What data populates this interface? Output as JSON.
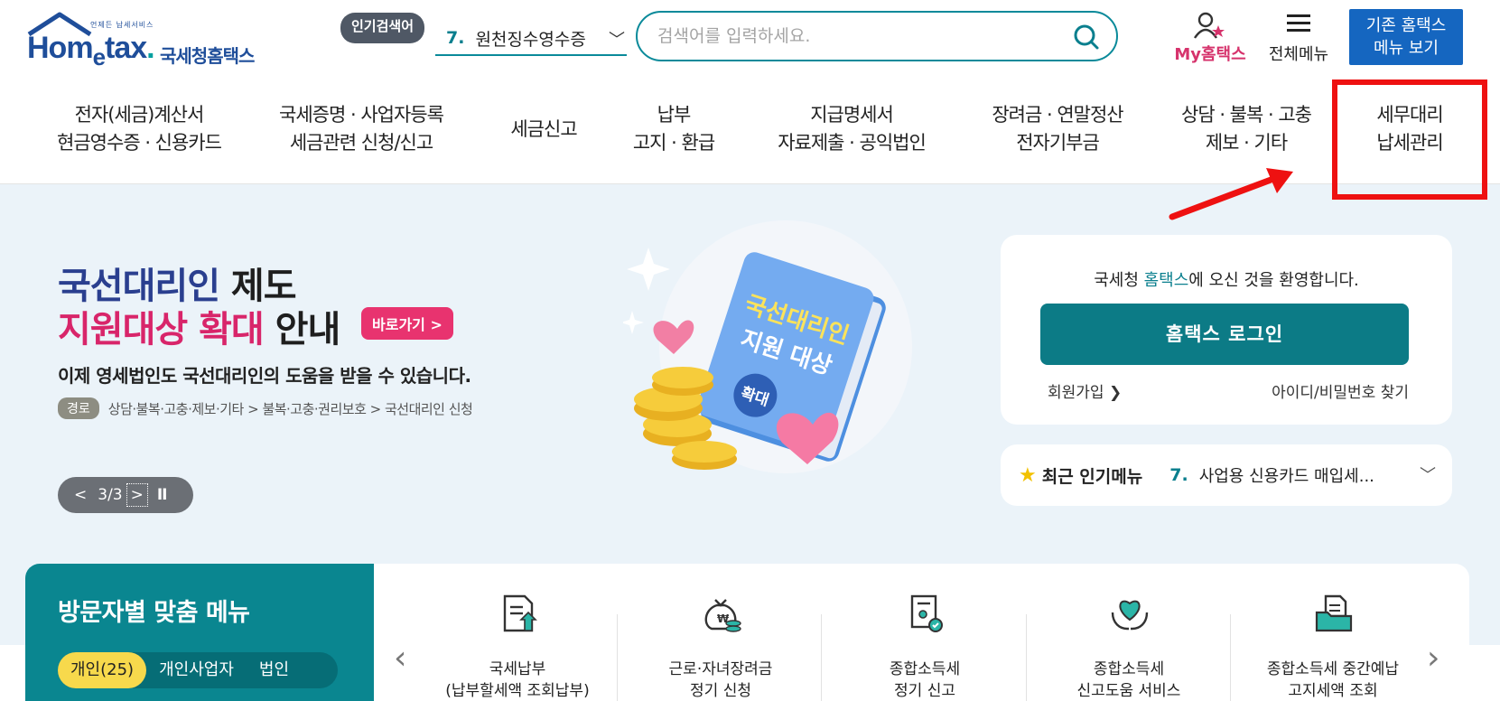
{
  "header": {
    "logo_tagline": "언제든 납세서비스",
    "logo_brand_pre": "Hom",
    "logo_brand_e": "e",
    "logo_brand_post": "tax",
    "logo_brand_dot": ".",
    "logo_kr": "국세청홈택스",
    "popular_badge": "인기검색어",
    "popular_num": "7.",
    "popular_text": "원천징수영수증",
    "search_placeholder": "검색어를 입력하세요.",
    "my_label": "My홈택스",
    "all_menu_label": "전체메뉴",
    "old_menu_line1": "기존 홈택스",
    "old_menu_line2": "메뉴 보기"
  },
  "nav": {
    "items": [
      {
        "l1": "전자(세금)계산서",
        "l2": "현금영수증 · 신용카드"
      },
      {
        "l1": "국세증명 · 사업자등록",
        "l2": "세금관련 신청/신고"
      },
      {
        "l1": "세금신고",
        "l2": ""
      },
      {
        "l1": "납부",
        "l2": "고지 · 환급"
      },
      {
        "l1": "지급명세서",
        "l2": "자료제출 · 공익법인"
      },
      {
        "l1": "장려금 · 연말정산",
        "l2": "전자기부금"
      },
      {
        "l1": "상담 · 불복 · 고충",
        "l2": "제보 · 기타"
      },
      {
        "l1": "세무대리",
        "l2": "납세관리"
      }
    ],
    "annotation_color": "#ee1111"
  },
  "hero": {
    "title1_a": "국선대리인",
    "title1_b": " 제도",
    "title2_a": "지원대상 확대",
    "title2_b": " 안내",
    "go_button": "바로가기 >",
    "subtitle": "이제 영세법인도 국선대리인의 도움을 받을 수 있습니다.",
    "route_tag": "경로",
    "route_path": "상담·불복·고충·제보·기타 > 불복·고충·권리보호 > 국선대리인 신청",
    "pager_prev": "<",
    "pager_count": "3/3",
    "pager_next": ">",
    "pager_pause": "II",
    "book_line1": "국선대리인",
    "book_line2": "지원 대상",
    "book_badge": "확대"
  },
  "login": {
    "welcome_a": "국세청 ",
    "welcome_hl": "홈택스",
    "welcome_b": "에 오신 것을 환영합니다.",
    "login_button": "홈택스 로그인",
    "join": "회원가입 ❯",
    "find": "아이디/비밀번호 찾기"
  },
  "popular_menu": {
    "title": "최근 인기메뉴",
    "num": "7.",
    "text": "사업용 신용카드 매입세..."
  },
  "visitor": {
    "title": "방문자별 맞춤 메뉴",
    "tabs": [
      "개인(25)",
      "개인사업자",
      "법인"
    ]
  },
  "services": [
    {
      "l1": "국세납부",
      "l2": "(납부할세액 조회납부)",
      "icon": "document-upload-icon"
    },
    {
      "l1": "근로·자녀장려금",
      "l2": "정기 신청",
      "icon": "money-bag-icon"
    },
    {
      "l1": "종합소득세",
      "l2": "정기 신고",
      "icon": "certificate-icon"
    },
    {
      "l1": "종합소득세",
      "l2": "신고도움 서비스",
      "icon": "heart-hands-icon"
    },
    {
      "l1": "종합소득세 중간예납",
      "l2": "고지세액 조회",
      "icon": "folder-document-icon"
    }
  ],
  "colors": {
    "brand_teal": "#0a8690",
    "brand_blue": "#1566c0",
    "accent_pink": "#e8336f",
    "hero_bg": "#ebf3f9"
  }
}
